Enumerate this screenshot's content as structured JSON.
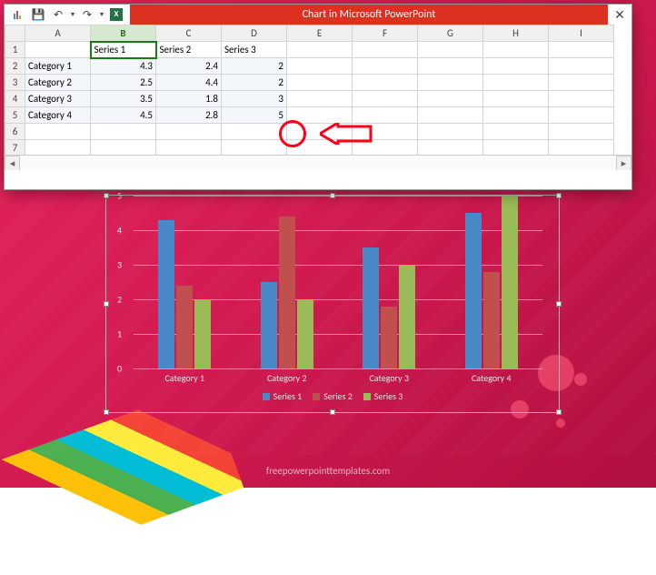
{
  "titlebar": {
    "title": "Chart in Microsoft PowerPoint"
  },
  "sheet": {
    "cols": [
      "A",
      "B",
      "C",
      "D",
      "E",
      "F",
      "G",
      "H",
      "I"
    ],
    "rows": [
      "1",
      "2",
      "3",
      "4",
      "5",
      "6",
      "7"
    ],
    "headers": {
      "b1": "Series 1",
      "c1": "Series 2",
      "d1": "Series 3"
    },
    "data": {
      "a2": "Category 1",
      "b2": "4.3",
      "c2": "2.4",
      "d2": "2",
      "a3": "Category 2",
      "b3": "2.5",
      "c3": "4.4",
      "d3": "2",
      "a4": "Category 3",
      "b4": "3.5",
      "c4": "1.8",
      "d4": "3",
      "a5": "Category 4",
      "b5": "4.5",
      "c5": "2.8",
      "d5": "5"
    }
  },
  "chart_data": {
    "type": "bar",
    "categories": [
      "Category 1",
      "Category 2",
      "Category 3",
      "Category 4"
    ],
    "series": [
      {
        "name": "Series 1",
        "values": [
          4.3,
          2.5,
          3.5,
          4.5
        ],
        "color": "#4a89c8"
      },
      {
        "name": "Series 2",
        "values": [
          2.4,
          4.4,
          1.8,
          2.8
        ],
        "color": "#c0504d"
      },
      {
        "name": "Series 3",
        "values": [
          2,
          2,
          3,
          5
        ],
        "color": "#9bbb59"
      }
    ],
    "ylim": [
      0,
      5
    ],
    "yticks": [
      0,
      1,
      2,
      3,
      4,
      5
    ]
  },
  "footer": {
    "text": "freepowerpointtemplates.com"
  }
}
